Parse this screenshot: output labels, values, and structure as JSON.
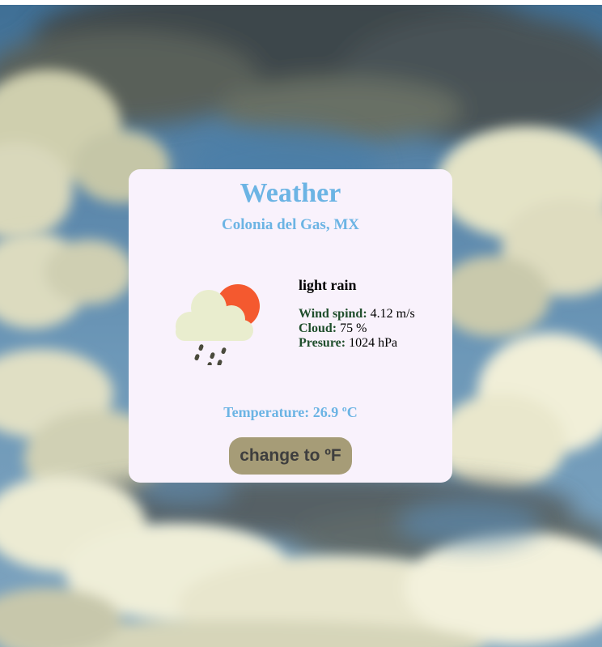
{
  "app": {
    "title": "Weather",
    "location": "Colonia del Gas, MX"
  },
  "current": {
    "description": "light rain",
    "wind": {
      "label": "Wind spind:",
      "value": "4.12 m/s"
    },
    "cloud": {
      "label": "Cloud:",
      "value": "75 %"
    },
    "pressure": {
      "label": "Presure:",
      "value": "1024 hPa"
    },
    "temperature": {
      "label": "Temperature:",
      "value": "26.9 ºC"
    },
    "icon": "sun-behind-rain-cloud-icon"
  },
  "controls": {
    "unit_toggle_label": "change to ºF"
  },
  "colors": {
    "accent": "#6cb4e4",
    "card_background": "#f9f2fc",
    "button_background": "#a69c77",
    "label_color": "#1f4e2c"
  }
}
